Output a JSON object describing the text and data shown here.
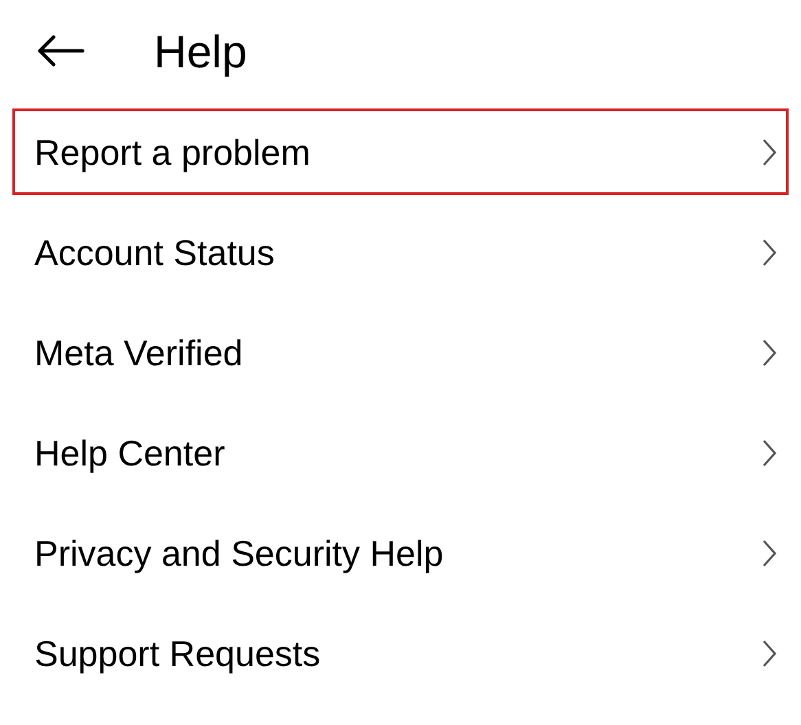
{
  "header": {
    "title": "Help"
  },
  "items": [
    {
      "label": "Report a problem",
      "highlighted": true
    },
    {
      "label": "Account Status",
      "highlighted": false
    },
    {
      "label": "Meta Verified",
      "highlighted": false
    },
    {
      "label": "Help Center",
      "highlighted": false
    },
    {
      "label": "Privacy and Security Help",
      "highlighted": false
    },
    {
      "label": "Support Requests",
      "highlighted": false
    }
  ]
}
